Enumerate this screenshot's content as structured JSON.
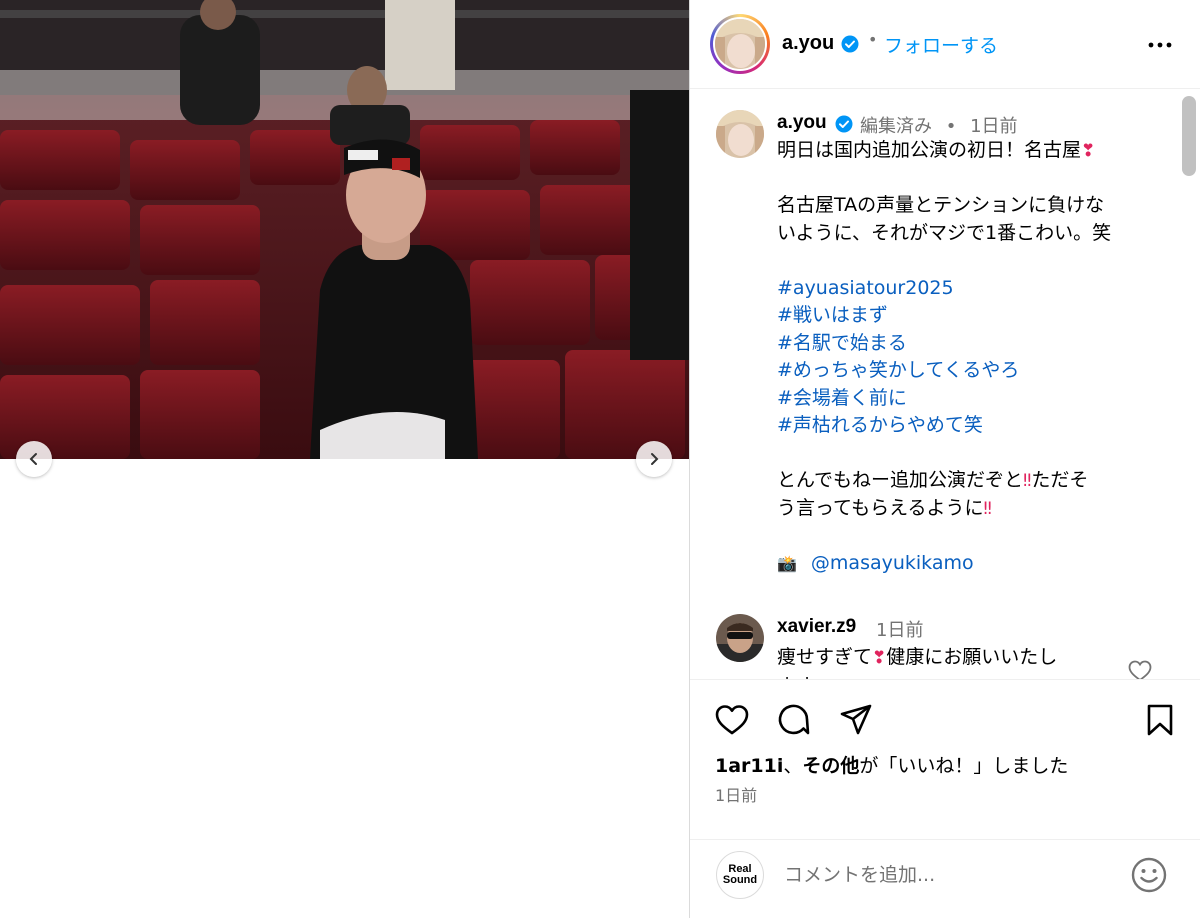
{
  "post": {
    "username": "a.you",
    "follow_label": "フォローする",
    "separator_dot": "•",
    "caption": {
      "username": "a.you",
      "edited": "編集済み",
      "dot": "•",
      "time": "1日前",
      "line1": "明日は国内追加公演の初日！名古屋",
      "line1_emoji": "❣",
      "line2": "名古屋TAの声量とテンションに負けな",
      "line3": "いように、それがマジで1番こわい。笑",
      "hashtags": [
        "#ayuasiatour2025",
        "#戦いはまず",
        "#名駅で始まる",
        "#めっちゃ笑かしてくるやろ",
        "#会場着く前に",
        "#声枯れるからやめて笑"
      ],
      "line4": "とんでもねー追加公演だぞと",
      "line4_emoji": "‼",
      "line4_tail": "ただそ",
      "line5": "う言ってもらえるように",
      "line5_emoji": "‼",
      "camera_emoji": "📸",
      "mention": "@masayukikamo"
    },
    "comments": [
      {
        "username": "xavier.z9",
        "time": "1日前",
        "text_a": "痩せすぎて",
        "emoji": "❣",
        "text_b": "健康にお願いいたし",
        "text_c": "ます"
      }
    ],
    "likes": {
      "user": "1ar11i",
      "mid": "、",
      "others": "その他",
      "tail": "が「いいね！」しました"
    },
    "post_time": "1日前",
    "compose": {
      "avatar_line1": "Real",
      "avatar_line2": "Sound",
      "placeholder": "コメントを追加..."
    }
  },
  "icons": {
    "header_more": "more-icon",
    "heart": "heart-icon",
    "comment": "comment-icon",
    "share": "share-icon",
    "save": "bookmark-icon",
    "emoji": "emoji-icon",
    "prev": "chevron-left-icon",
    "next": "chevron-right-icon",
    "verified": "verified-badge-icon"
  },
  "colors": {
    "link": "#0095f6",
    "hashtag": "#0a5fbf",
    "muted": "#737373",
    "verified": "#0095f6"
  }
}
